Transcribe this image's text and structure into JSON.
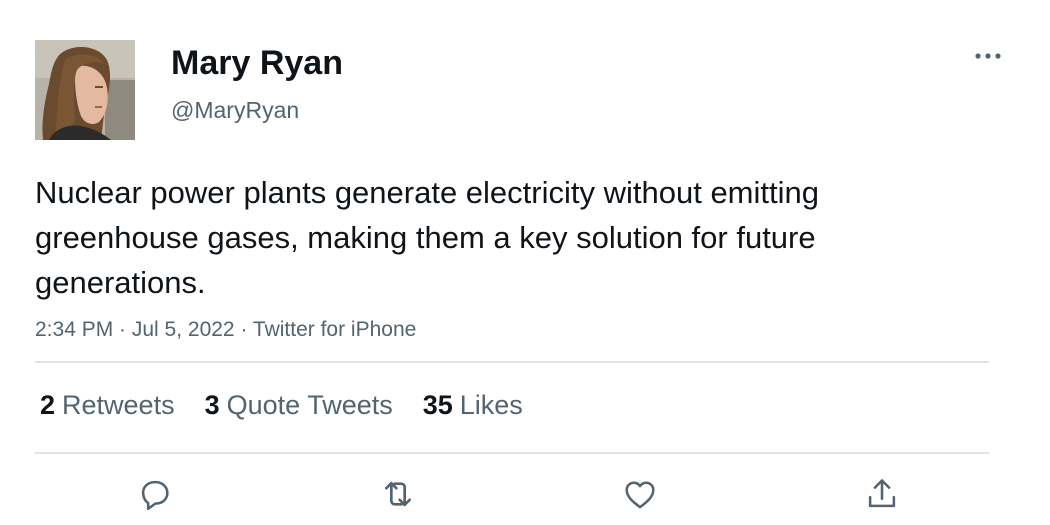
{
  "tweet": {
    "display_name": "Mary Ryan",
    "handle": "@MaryRyan",
    "text": "Nuclear power plants generate electricity without emitting greenhouse gases, making them a key solution for future generations.",
    "timestamp": "2:34 PM · Jul 5, 2022 · Twitter for iPhone"
  },
  "stats": {
    "retweets": {
      "count": "2",
      "label": "Retweets"
    },
    "quotes": {
      "count": "3",
      "label": "Quote Tweets"
    },
    "likes": {
      "count": "35",
      "label": "Likes"
    }
  },
  "actions": [
    "reply-icon",
    "retweet-icon",
    "like-icon",
    "share-icon"
  ],
  "colors": {
    "text": "#0f1419",
    "secondary": "#536471",
    "divider": "#dfe3e6"
  }
}
